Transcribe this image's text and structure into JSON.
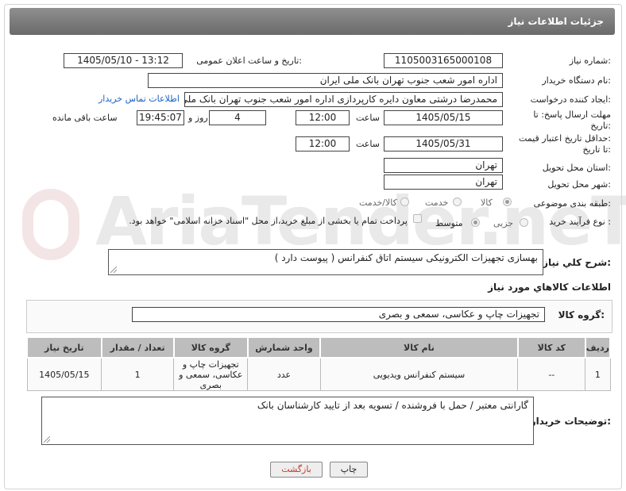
{
  "header": {
    "title": "جزئیات اطلاعات نیاز"
  },
  "form": {
    "need_number": {
      "label": "شماره نیاز:",
      "value": "1105003165000108"
    },
    "announce_datetime": {
      "label": "تاریخ و ساعت اعلان عمومی:",
      "value": "1405/05/10 - 13:12"
    },
    "buyer_org": {
      "label": "نام دستگاه خریدار:",
      "value": "اداره امور شعب جنوب تهران بانک ملی ایران"
    },
    "requester": {
      "label": "ایجاد کننده درخواست:",
      "value": "محمدرضا درشتی معاون دایره کارپردازی اداره امور شعب جنوب تهران بانک ملی ایران",
      "contact_link": "اطلاعات تماس خریدار"
    },
    "reply_deadline": {
      "label_line1": "مهلت ارسال پاسخ: تا",
      "label_line2": "تاریخ:",
      "date": "1405/05/15",
      "time_label": "ساعت",
      "time": "12:00",
      "days": "4",
      "days_label": "روز و",
      "remaining": "19:45:07",
      "remaining_label": "ساعت باقی مانده"
    },
    "price_validity": {
      "label_line1": "حداقل تاریخ اعتبار قیمت:",
      "label_line2": "تا تاریخ:",
      "date": "1405/05/31",
      "time_label": "ساعت",
      "time": "12:00"
    },
    "delivery_province": {
      "label": "استان محل تحویل:",
      "value": "تهران"
    },
    "delivery_city": {
      "label": "شهر محل تحویل:",
      "value": "تهران"
    },
    "category": {
      "label": "طبقه بندی موضوعی:",
      "options": [
        "کالا",
        "خدمت",
        "کالا/خدمت"
      ],
      "selected": "کالا"
    },
    "process": {
      "label": "نوع فرآیند خرید :",
      "options": [
        "جزیی",
        "متوسط"
      ],
      "selected": "متوسط",
      "payment_note": "پرداخت تمام یا بخشی از مبلغ خرید،از محل \"اسناد خزانه اسلامی\" خواهد بود."
    }
  },
  "summary": {
    "label": "شرح کلي نياز:",
    "value": "بهسازی تجهیزات الکترونیکی سیستم اتاق کنفرانس ( پیوست دارد )"
  },
  "goods_section": {
    "title": "اطلاعات کالاهاي مورد نياز"
  },
  "goods_group": {
    "label": "گروه کالا:",
    "value": "تجهیزات چاپ و عکاسی، سمعی و بصری"
  },
  "table": {
    "headers": [
      "ردیف",
      "کد کالا",
      "نام کالا",
      "واحد شمارش",
      "گروه کالا",
      "تعداد / مقدار",
      "تاریخ نیاز"
    ],
    "rows": [
      {
        "row": "1",
        "code": "--",
        "name": "سیستم کنفرانس ویدیویی",
        "unit": "عدد",
        "group": "تجهیزات چاپ و عکاسی، سمعی و بصری",
        "qty": "1",
        "date": "1405/05/15"
      }
    ]
  },
  "buyer_notes": {
    "label": "توضیحات خریدار:",
    "value": "گارانتی معتبر / حمل با فروشنده / تسویه بعد از تایید کارشناسان بانک"
  },
  "buttons": {
    "print": "چاپ",
    "back": "بازگشت"
  },
  "watermark": "AriaTender.neT",
  "colors": {
    "titlebar": "#7a7a7a",
    "link": "#1a62c4",
    "back_button_text": "#c0392b"
  }
}
